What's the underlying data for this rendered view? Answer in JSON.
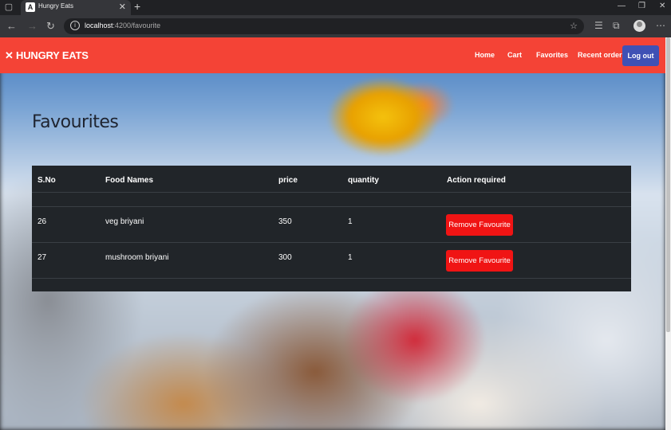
{
  "browser": {
    "tab_title": "Hungry Eats",
    "tab_favicon": "A",
    "url_host": "localhost",
    "url_rest": ":4200/favourite"
  },
  "navbar": {
    "brand": "HUNGRY EATS",
    "links": [
      "Home",
      "Cart",
      "Favorites",
      "Recent order"
    ],
    "logout": "Log out"
  },
  "page": {
    "title": "Favourites"
  },
  "table": {
    "headers": [
      "S.No",
      "Food Names",
      "price",
      "quantity",
      "Action required"
    ],
    "rows": [
      {
        "sno": "26",
        "name": "veg briyani",
        "price": "350",
        "quantity": "1",
        "action": "Remove Favourite"
      },
      {
        "sno": "27",
        "name": "mushroom briyani",
        "price": "300",
        "quantity": "1",
        "action": "Remove Favourite"
      }
    ]
  },
  "colors": {
    "navbar": "#f44336",
    "logout_button": "#3f51b5",
    "remove_button": "#f01414",
    "table_bg": "#212529"
  }
}
